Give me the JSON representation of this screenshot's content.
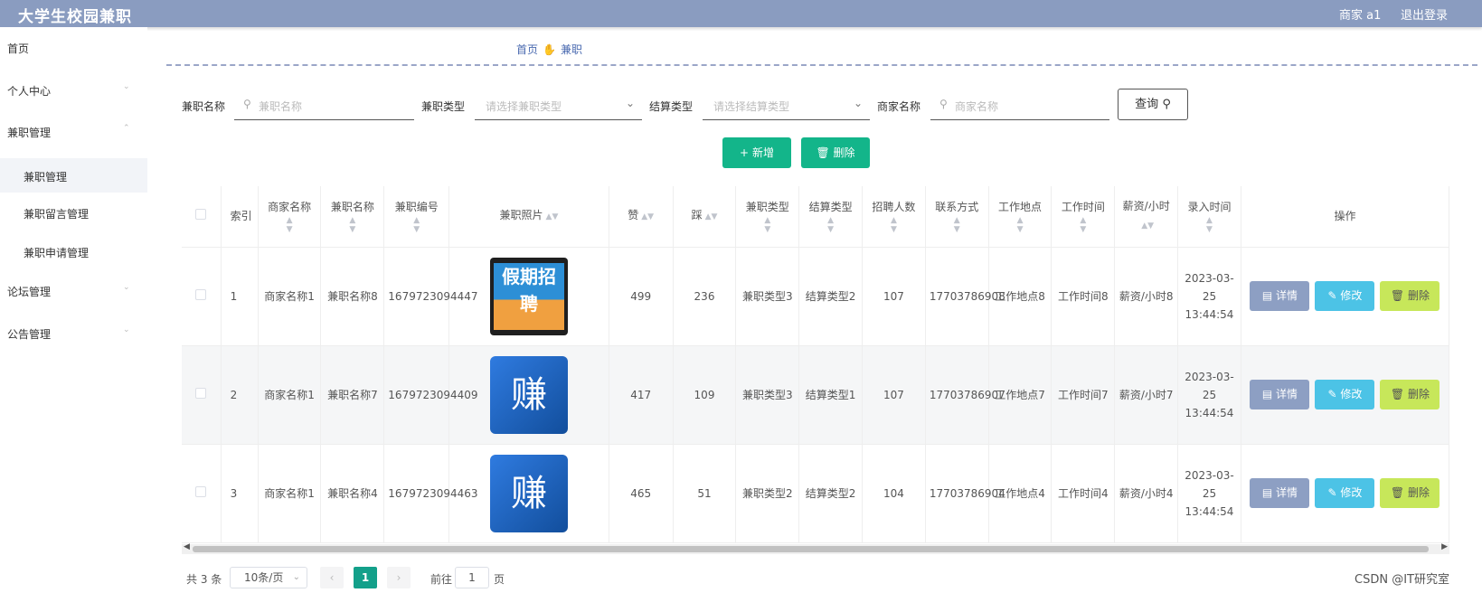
{
  "app": {
    "title": "大学生校园兼职",
    "user": "商家 a1",
    "logout": "退出登录"
  },
  "sidebar": {
    "items": [
      {
        "label": "首页"
      },
      {
        "label": "个人中心",
        "chevron": "chevron-down-icon"
      },
      {
        "label": "兼职管理",
        "chevron": "chevron-up-icon"
      },
      {
        "label": "论坛管理",
        "chevron": "chevron-down-icon"
      },
      {
        "label": "公告管理",
        "chevron": "chevron-down-icon"
      }
    ],
    "sub_items": [
      {
        "label": "兼职管理",
        "active": true
      },
      {
        "label": "兼职留言管理"
      },
      {
        "label": "兼职申请管理"
      }
    ]
  },
  "breadcrumb": {
    "home": "首页",
    "current": "兼职",
    "separator_icon": "hand-icon"
  },
  "search": {
    "name_label": "兼职名称",
    "name_placeholder": "兼职名称",
    "type_label": "兼职类型",
    "type_placeholder": "请选择兼职类型",
    "settle_label": "结算类型",
    "settle_placeholder": "请选择结算类型",
    "merchant_label": "商家名称",
    "merchant_placeholder": "商家名称",
    "query_button": "查询"
  },
  "actions": {
    "add": "新增",
    "delete": "删除"
  },
  "table": {
    "headers": [
      "索引",
      "商家名称",
      "兼职名称",
      "兼职编号",
      "兼职照片",
      "赞",
      "踩",
      "兼职类型",
      "结算类型",
      "招聘人数",
      "联系方式",
      "工作地点",
      "工作时间",
      "薪资/小时",
      "录入时间",
      "操作"
    ],
    "rows": [
      {
        "index": "1",
        "merchant": "商家名称1",
        "name": "兼职名称8",
        "code": "1679723094447",
        "photo": "poster",
        "photo_text": "假期招聘",
        "like": "499",
        "dislike": "236",
        "type": "兼职类型3",
        "settle": "结算类型2",
        "count": "107",
        "contact": "17703786908",
        "place": "工作地点8",
        "time": "工作时间8",
        "salary": "薪资/小时8",
        "created": "2023-03-25 13:44:54"
      },
      {
        "index": "2",
        "merchant": "商家名称1",
        "name": "兼职名称7",
        "code": "1679723094409",
        "photo": "blue",
        "photo_text": "赚",
        "like": "417",
        "dislike": "109",
        "type": "兼职类型3",
        "settle": "结算类型1",
        "count": "107",
        "contact": "17703786907",
        "place": "工作地点7",
        "time": "工作时间7",
        "salary": "薪资/小时7",
        "created": "2023-03-25 13:44:54"
      },
      {
        "index": "3",
        "merchant": "商家名称1",
        "name": "兼职名称4",
        "code": "1679723094463",
        "photo": "blue",
        "photo_text": "赚",
        "like": "465",
        "dislike": "51",
        "type": "兼职类型2",
        "settle": "结算类型2",
        "count": "104",
        "contact": "17703786904",
        "place": "工作地点4",
        "time": "工作时间4",
        "salary": "薪资/小时4",
        "created": "2023-03-25 13:44:54"
      }
    ],
    "row_actions": {
      "detail": "详情",
      "edit": "修改",
      "delete": "删除"
    }
  },
  "pagination": {
    "total": "共 3 条",
    "page_size": "10条/页",
    "current": "1",
    "goto_label": "前往",
    "goto_value": "1",
    "page_suffix": "页"
  },
  "watermark": "CSDN @IT研究室",
  "colors": {
    "topbar": "#8a9cc0",
    "primary": "#13b58a",
    "detail": "#8d9fc3",
    "edit": "#4cc3e6",
    "delete": "#c7e75a"
  }
}
